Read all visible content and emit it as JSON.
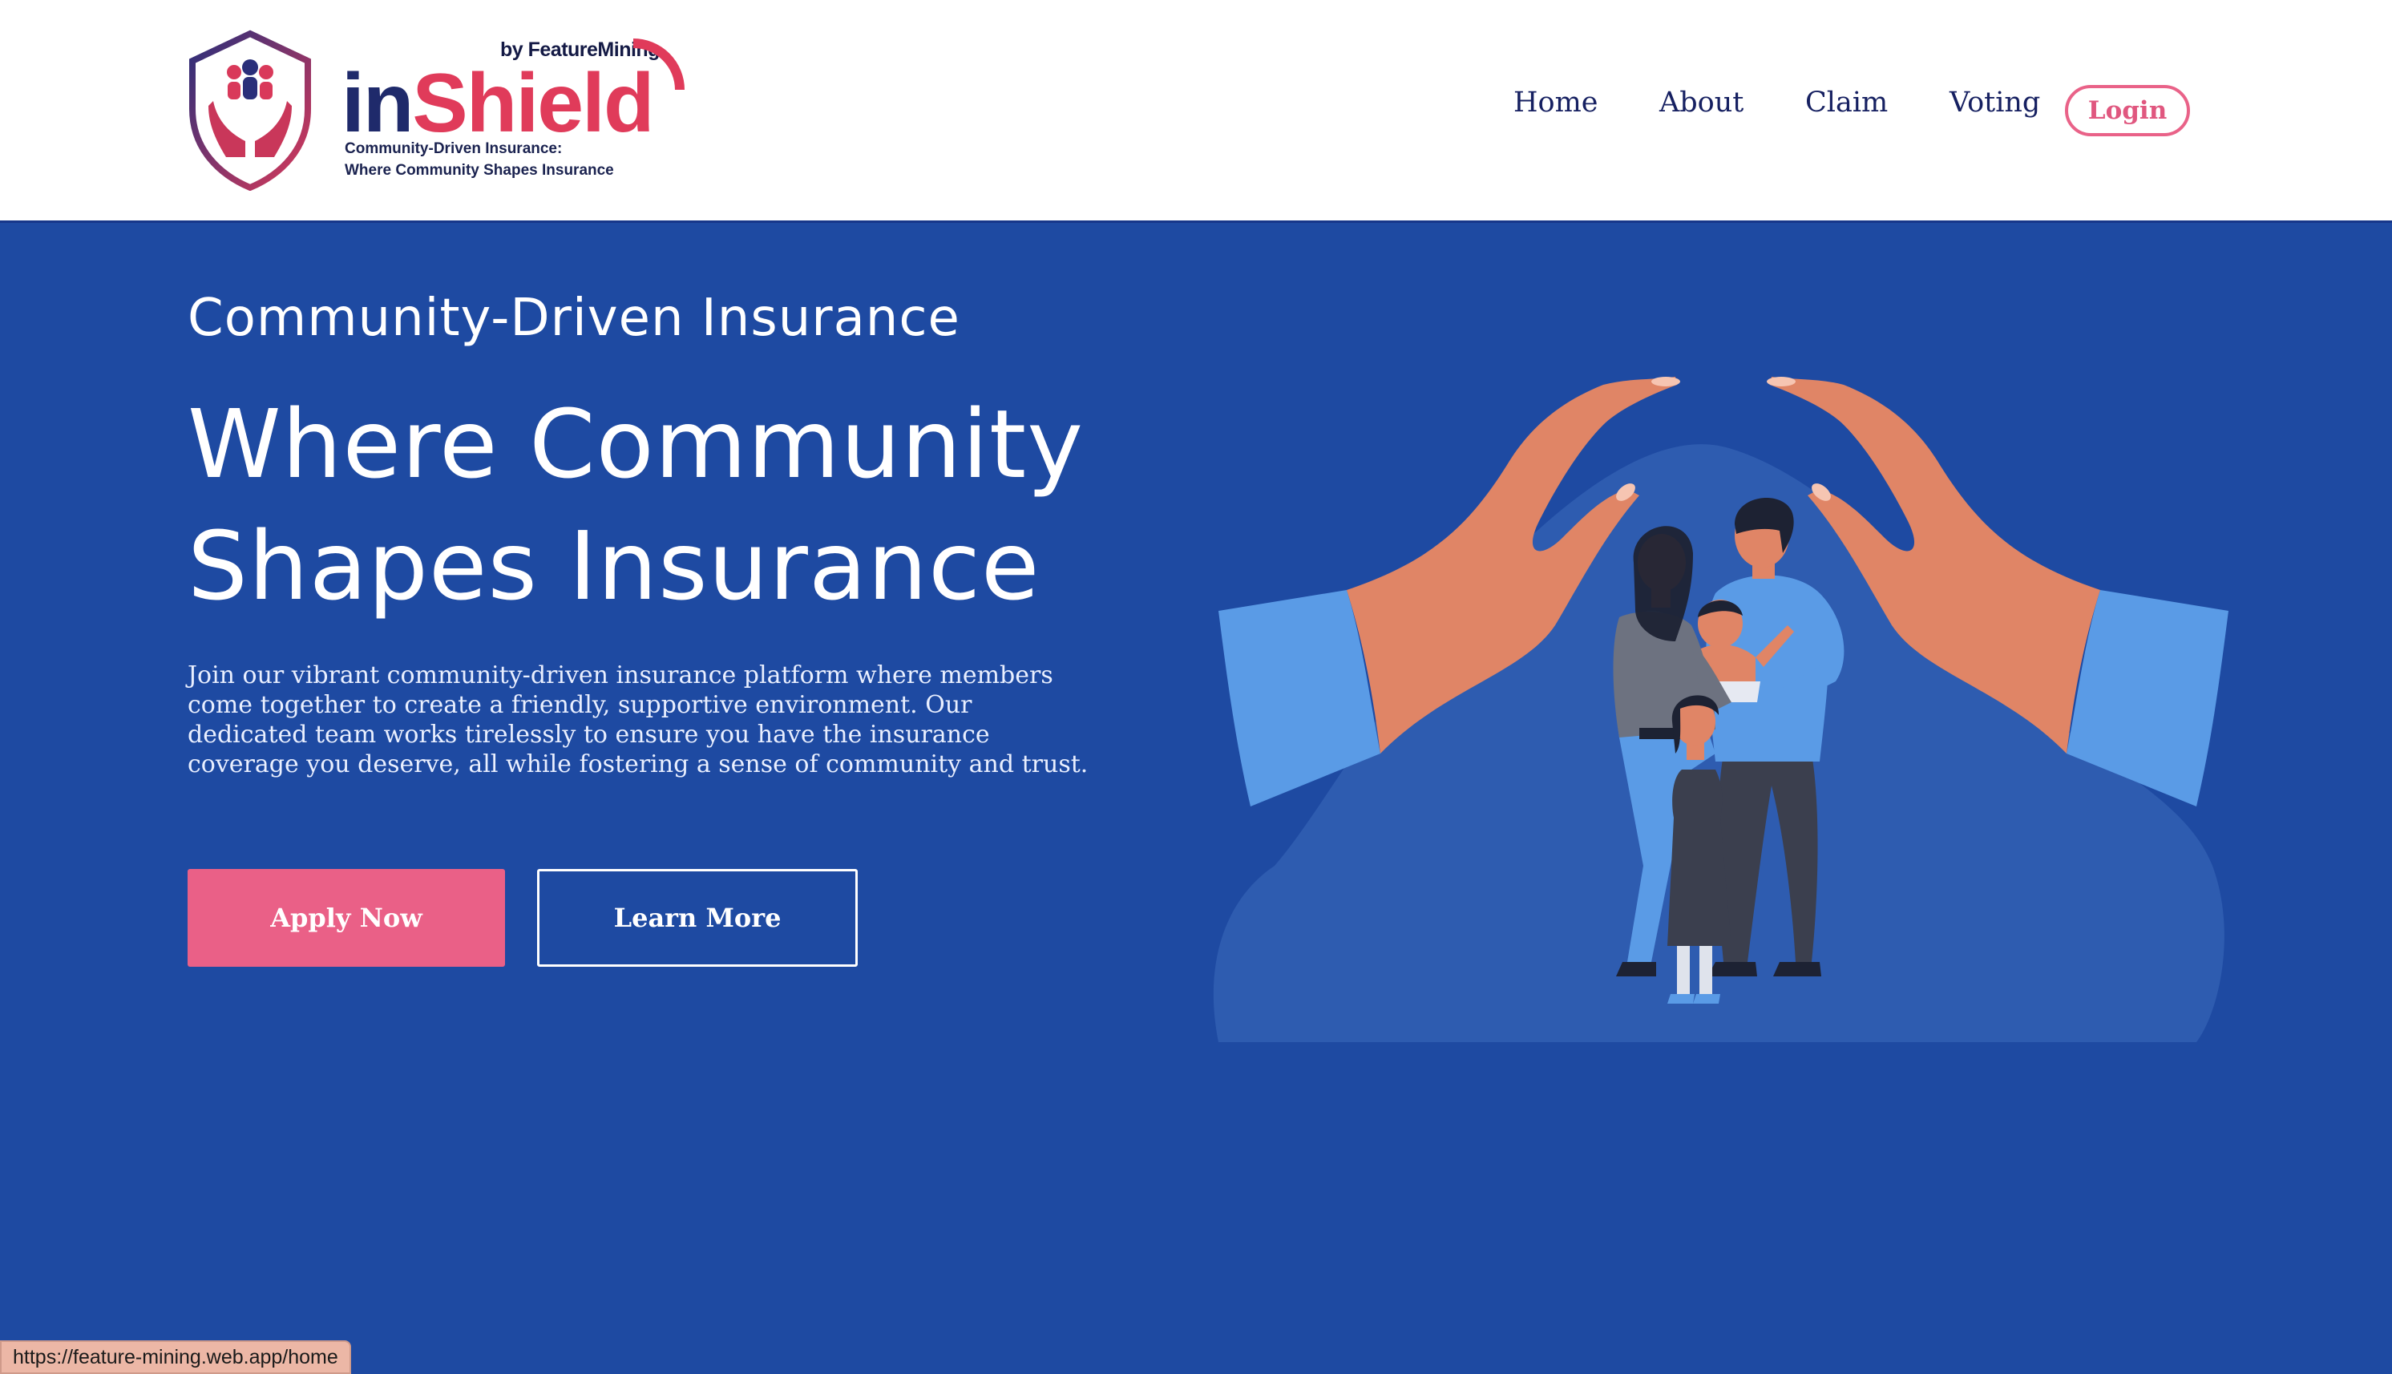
{
  "brand": {
    "by_line": "by FeatureMining",
    "name_part1": "in",
    "name_part2": "Shield",
    "tagline_line1": "Community-Driven Insurance:",
    "tagline_line2": "Where Community Shapes Insurance",
    "colors": {
      "navy": "#1f2a6b",
      "red": "#e03b5a"
    }
  },
  "nav": {
    "items": [
      {
        "label": "Home"
      },
      {
        "label": "About"
      },
      {
        "label": "Claim"
      },
      {
        "label": "Voting"
      }
    ],
    "login_label": "Login"
  },
  "hero": {
    "subtitle": "Community-Driven Insurance",
    "title_line1": "Where Community",
    "title_line2": "Shapes Insurance",
    "description": "Join our vibrant community-driven insurance platform where members come together to create a friendly, supportive environment. Our dedicated team works tirelessly to ensure you have the insurance coverage you deserve, all while fostering a sense of community and trust.",
    "apply_label": "Apply Now",
    "learn_label": "Learn More",
    "background": "#1e4aa2",
    "accent": "#ea6087"
  },
  "status_bar": {
    "url": "https://feature-mining.web.app/home"
  }
}
